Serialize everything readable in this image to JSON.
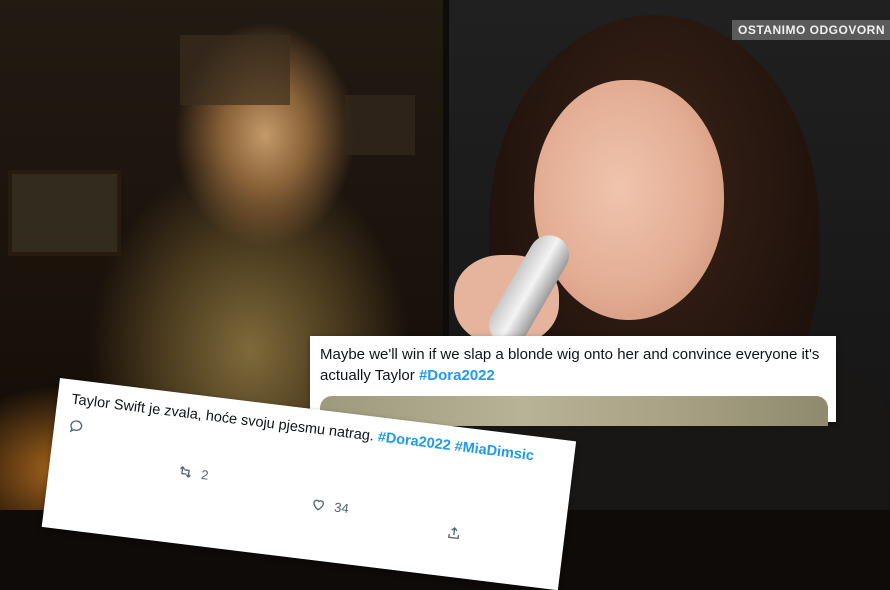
{
  "overlay": {
    "watermark": "OSTANIMO ODGOVORN"
  },
  "tweet_right": {
    "text": "Maybe we'll win if we slap a blonde wig onto her and convince everyone it's actually Taylor",
    "hashtag": "#Dora2022"
  },
  "tweet_left": {
    "text_line1": "Taylor Swift je zvala, hoće svoju pjesmu natrag.",
    "hashtag1": "#Dora2022",
    "hashtag2": "#MiaDimsic",
    "retweets": "2",
    "likes": "34"
  },
  "icons": [
    "reply-icon",
    "retweet-icon",
    "like-icon",
    "share-icon"
  ]
}
